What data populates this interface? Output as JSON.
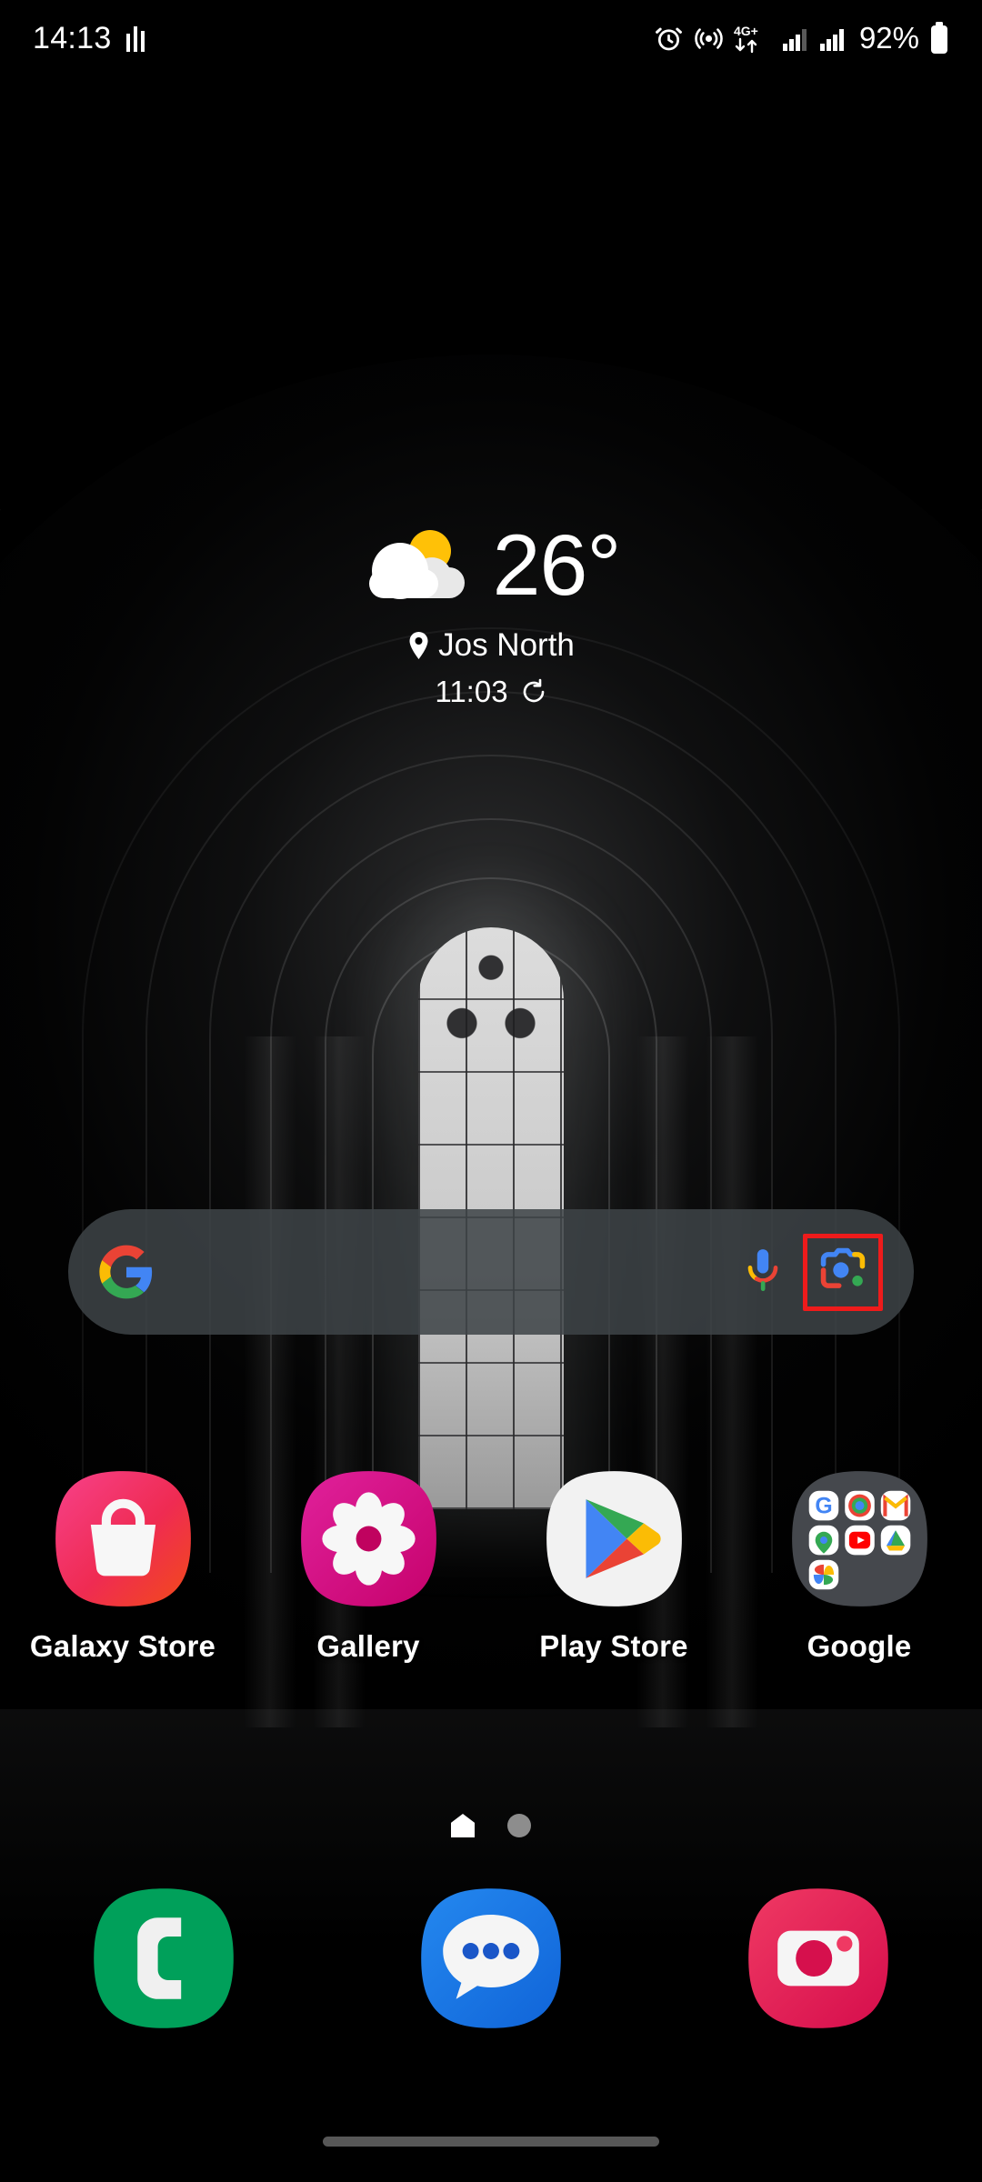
{
  "status_bar": {
    "time": "14:13",
    "battery_percent": "92%",
    "network_label": "4G+",
    "icons": [
      {
        "name": "signal-bars-icon"
      },
      {
        "name": "alarm-icon"
      },
      {
        "name": "hotspot-icon"
      },
      {
        "name": "mobile-data-arrows-icon"
      },
      {
        "name": "sim1-signal-icon"
      },
      {
        "name": "sim2-signal-icon"
      },
      {
        "name": "battery-icon"
      }
    ]
  },
  "weather": {
    "temperature": "26°",
    "location": "Jos North",
    "updated_time": "11:03",
    "condition_icon": "partly-cloudy-icon",
    "location_icon": "location-pin-icon",
    "refresh_icon": "refresh-icon"
  },
  "search": {
    "placeholder": "",
    "value": "",
    "google_logo": "google-g-icon",
    "mic_icon": "google-mic-icon",
    "lens_icon": "google-lens-icon",
    "highlight_color": "#ee1b1b"
  },
  "apps": [
    {
      "label": "Galaxy Store",
      "icon": "galaxy-store-icon",
      "color": "#f2356b"
    },
    {
      "label": "Gallery",
      "icon": "gallery-icon",
      "color": "#d6137f"
    },
    {
      "label": "Play Store",
      "icon": "play-store-icon",
      "color": "#f1f1f1"
    },
    {
      "label": "Google",
      "icon": "google-folder-icon",
      "color": "#45484d"
    }
  ],
  "folder": {
    "name": "Google",
    "items": [
      "google-search-icon",
      "chrome-icon",
      "gmail-icon",
      "maps-icon",
      "youtube-icon",
      "drive-icon",
      "photos-icon"
    ]
  },
  "page_indicator": {
    "pages": 2,
    "active_page": 1,
    "active_icon": "home-page-icon"
  },
  "dock": [
    {
      "label": "Phone",
      "icon": "phone-icon",
      "color": "#00a05a"
    },
    {
      "label": "Messages",
      "icon": "messages-icon",
      "color": "#1d7ceb"
    },
    {
      "label": "Camera",
      "icon": "camera-icon",
      "color": "#e31452"
    }
  ],
  "nav_bar": {
    "gesture_pill": "gesture-handle"
  }
}
